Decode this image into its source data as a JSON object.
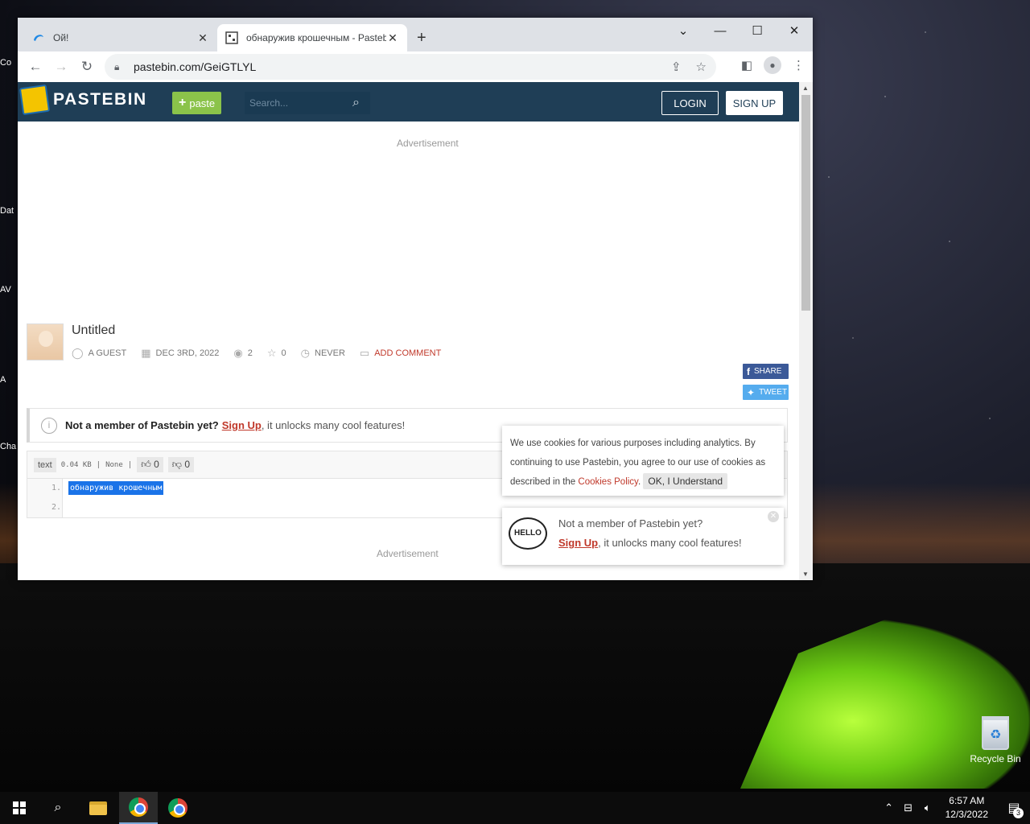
{
  "desktop": {
    "recycle_bin_label": "Recycle Bin",
    "left_icon_fragments": [
      "Co",
      "Dat",
      "AV",
      "A",
      "Cha"
    ]
  },
  "browser": {
    "tabs": [
      {
        "title": "Ой!",
        "active": false
      },
      {
        "title": "обнаружив крошечным - Pastebin",
        "active": true
      }
    ],
    "url": "pastebin.com/GeiGTLYL"
  },
  "pastebin": {
    "brand": "PASTEBIN",
    "paste_button_label": "paste",
    "search_placeholder": "Search...",
    "login_label": "LOGIN",
    "signup_label": "SIGN UP",
    "ad_label_top": "Advertisement",
    "ad_label_bottom": "Advertisement",
    "post": {
      "title": "Untitled",
      "author": "A GUEST",
      "date": "DEC 3RD, 2022",
      "views": "2",
      "stars": "0",
      "expiration": "NEVER",
      "add_comment": "ADD COMMENT"
    },
    "share_label": "SHARE",
    "tweet_label": "TWEET",
    "notice": {
      "bold": "Not a member of Pastebin yet?",
      "link": "Sign Up",
      "rest": ", it unlocks many cool features!"
    },
    "code": {
      "format": "text",
      "size": "0.04 KB",
      "sep": "|",
      "category": "None",
      "likes": "0",
      "dislikes": "0",
      "line_numbers": [
        "1.",
        "2."
      ],
      "line1": "обнаружив крошечным"
    },
    "cookie": {
      "text": "We use cookies for various purposes including analytics. By continuing to use Pastebin, you agree to our use of cookies as described in the ",
      "policy_link": "Cookies Policy",
      "period": ".",
      "ok_label": "OK, I Understand"
    },
    "hello_popup": {
      "bubble": "HELLO",
      "line1": "Not a member of Pastebin yet?",
      "link": "Sign Up",
      "line2_rest": ", it unlocks many cool features!"
    }
  },
  "taskbar": {
    "time": "6:57 AM",
    "date": "12/3/2022",
    "notification_count": "3"
  }
}
